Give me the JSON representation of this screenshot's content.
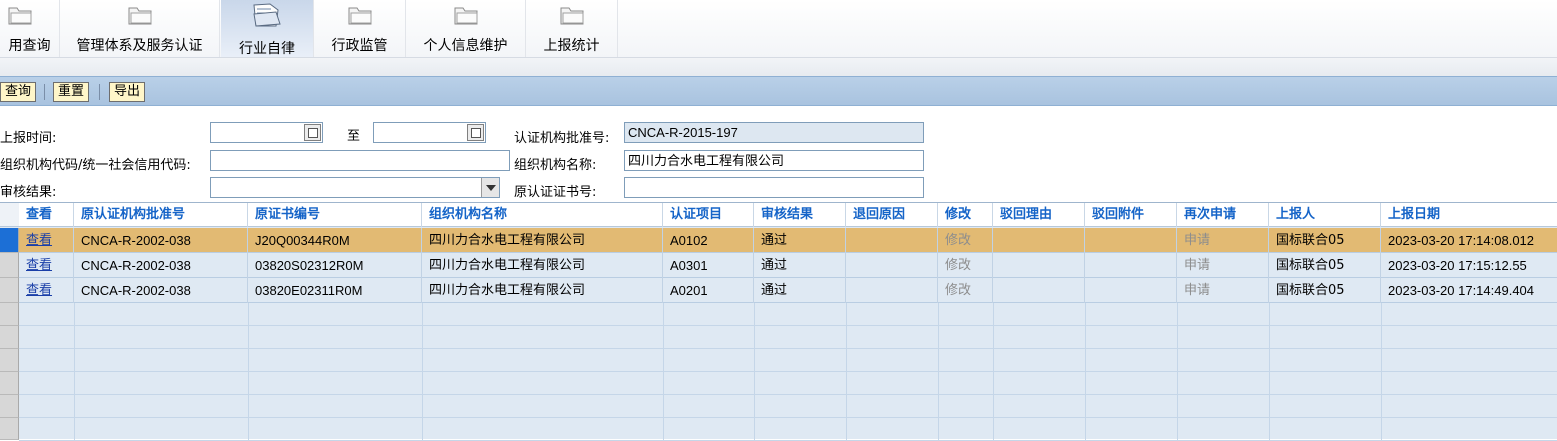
{
  "nav": {
    "tabs": [
      {
        "label": "用查询",
        "active": false
      },
      {
        "label": "管理体系及服务认证",
        "active": false
      },
      {
        "label": "行业自律",
        "active": true
      },
      {
        "label": "行政监管",
        "active": false
      },
      {
        "label": "个人信息维护",
        "active": false
      },
      {
        "label": "上报统计",
        "active": false
      }
    ]
  },
  "toolbar": {
    "query": "查询",
    "reset": "重置",
    "export": "导出"
  },
  "filters": {
    "report_time_label": "上报时间:",
    "report_time_from": "",
    "to_label": "至",
    "report_time_to": "",
    "approval_no_label": "认证机构批准号:",
    "approval_no_value": "CNCA-R-2015-197",
    "org_code_label": "组织机构代码/统一社会信用代码:",
    "org_code_value": "",
    "org_name_label": "组织机构名称:",
    "org_name_value": "四川力合水电工程有限公司",
    "review_result_label": "审核结果:",
    "review_result_value": "",
    "orig_cert_no_label": "原认证证书号:",
    "orig_cert_no_value": ""
  },
  "table": {
    "columns": [
      "查看",
      "原认证机构批准号",
      "原证书编号",
      "组织机构名称",
      "认证项目",
      "审核结果",
      "退回原因",
      "修改",
      "驳回理由",
      "驳回附件",
      "再次申请",
      "上报人",
      "上报日期"
    ],
    "rows": [
      {
        "view": "查看",
        "orig_approval_no": "CNCA-R-2002-038",
        "orig_cert_no": "J20Q00344R0M",
        "org_name": "四川力合水电工程有限公司",
        "item": "A0102",
        "result": "通过",
        "return_reason": "",
        "modify": "修改",
        "reject_reason": "",
        "reject_attachment": "",
        "reapply": "申请",
        "reporter": "国标联合05",
        "report_date": "2023-03-20 17:14:08.012",
        "selected": true
      },
      {
        "view": "查看",
        "orig_approval_no": "CNCA-R-2002-038",
        "orig_cert_no": "03820S02312R0M",
        "org_name": "四川力合水电工程有限公司",
        "item": "A0301",
        "result": "通过",
        "return_reason": "",
        "modify": "修改",
        "reject_reason": "",
        "reject_attachment": "",
        "reapply": "申请",
        "reporter": "国标联合05",
        "report_date": "2023-03-20 17:15:12.55",
        "selected": false
      },
      {
        "view": "查看",
        "orig_approval_no": "CNCA-R-2002-038",
        "orig_cert_no": "03820E02311R0M",
        "org_name": "四川力合水电工程有限公司",
        "item": "A0201",
        "result": "通过",
        "return_reason": "",
        "modify": "修改",
        "reject_reason": "",
        "reject_attachment": "",
        "reapply": "申请",
        "reporter": "国标联合05",
        "report_date": "2023-03-20 17:14:49.404",
        "selected": false
      }
    ]
  },
  "colors": {
    "header_text": "#1564c8",
    "selected_row": "#e2ba73",
    "grid_bg": "#dfe9f3",
    "toolbar": "#b3cbe5",
    "button_bg": "#fff6c9"
  }
}
